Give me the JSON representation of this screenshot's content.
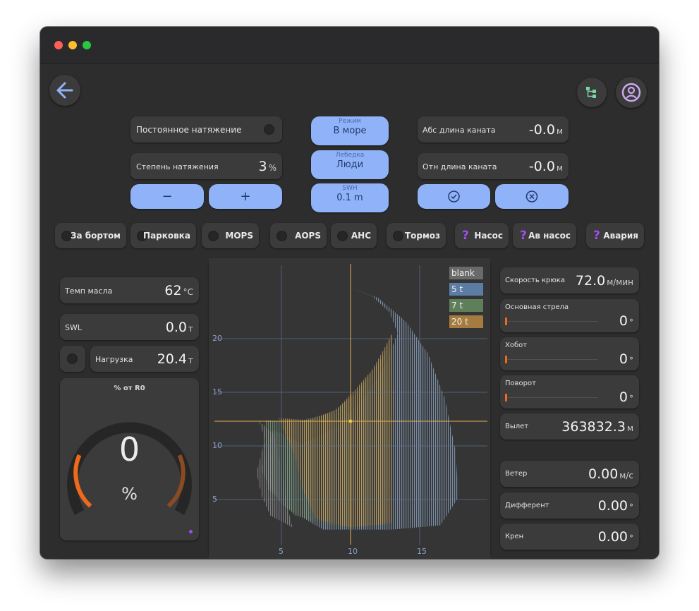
{
  "window": {
    "traffic_lights": [
      "#fe5f57",
      "#febc2e",
      "#28c840"
    ]
  },
  "header": {
    "back_icon": "arrow-left-icon",
    "tree_icon": "tree-structure-icon",
    "user_icon": "user-circle-icon"
  },
  "tension": {
    "constant_label": "Постоянное натяжение",
    "degree_label": "Степень натяжения",
    "degree_value": "3",
    "degree_unit": "%",
    "minus_label": "−",
    "plus_label": "+"
  },
  "mode": {
    "regime_caption": "Режим",
    "regime_value": "В море",
    "winch_caption": "Лебедка",
    "winch_value": "Люди",
    "swh_caption": "SWH",
    "swh_value": "0.1 m"
  },
  "rope": {
    "abs_label": "Абс длина каната",
    "abs_value": "-0.0",
    "abs_unit": "м",
    "rel_label": "Отн длина каната",
    "rel_value": "-0.0",
    "rel_unit": "м",
    "confirm_icon": "check-circle-icon",
    "cancel_icon": "x-circle-icon"
  },
  "flags": [
    {
      "label": "За бортом",
      "indicator": "dot"
    },
    {
      "label": "Парковка",
      "indicator": "dot"
    },
    {
      "label": "MOPS",
      "indicator": "dot"
    },
    {
      "label": "AOPS",
      "indicator": "dot"
    },
    {
      "label": "AHC",
      "indicator": "dot"
    },
    {
      "label": "Тормоз",
      "indicator": "dot"
    },
    {
      "label": "Насос",
      "indicator": "?"
    },
    {
      "label": "Ав насос",
      "indicator": "?"
    },
    {
      "label": "Авария",
      "indicator": "?"
    }
  ],
  "left": {
    "oil_label": "Темп масла",
    "oil_value": "62",
    "oil_unit": "°C",
    "swl_label": "SWL",
    "swl_value": "0.0",
    "swl_unit": "т",
    "load_label": "Нагрузка",
    "load_value": "20.4",
    "load_unit": "т",
    "gauge_title": "% от R0",
    "gauge_value": "0",
    "gauge_unit": "%",
    "gauge_level": 0,
    "accent": "#ee6a1a"
  },
  "chart_data": {
    "type": "area",
    "x_ticks": [
      "5",
      "10",
      "15"
    ],
    "y_ticks": [
      "5",
      "10",
      "15",
      "20"
    ],
    "xlim": [
      0,
      20
    ],
    "ylim": [
      0,
      27
    ],
    "series": [
      {
        "name": "blank",
        "color": "#6a6a6a"
      },
      {
        "name": "5 t",
        "color": "#5b7ca3"
      },
      {
        "name": "7 t",
        "color": "#5f7f5a"
      },
      {
        "name": "20 t",
        "color": "#a67b3f"
      }
    ],
    "cursor": {
      "x": 10,
      "y": 12.3
    },
    "grid": true
  },
  "right": {
    "hook_label": "Скорость крюка",
    "hook_value": "72.0",
    "hook_unit": "м/мин",
    "boom_label": "Основная стрела",
    "boom_value": "0",
    "boom_unit": "°",
    "jib_label": "Хобот",
    "jib_value": "0",
    "jib_unit": "°",
    "slew_label": "Поворот",
    "slew_value": "0",
    "slew_unit": "°",
    "reach_label": "Вылет",
    "reach_value": "363832.3",
    "reach_unit": "м",
    "wind_label": "Ветер",
    "wind_value": "0.00",
    "wind_unit": "м/с",
    "trim_label": "Дифферент",
    "trim_value": "0.00",
    "trim_unit": "°",
    "heel_label": "Крен",
    "heel_value": "0.00",
    "heel_unit": "°"
  }
}
